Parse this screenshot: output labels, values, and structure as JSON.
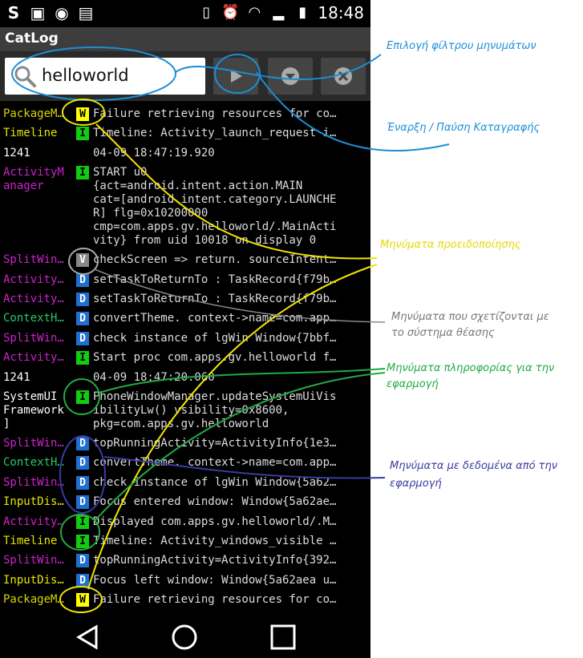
{
  "status_bar": {
    "left_icons": [
      "swiftkey-icon",
      "gallery-icon",
      "browser-icon",
      "briefcase-icon"
    ],
    "right_icons": [
      "vibrate-icon",
      "alarm-icon",
      "wifi-icon",
      "signal-icon",
      "battery-icon"
    ],
    "time": "18:48"
  },
  "app": {
    "title": "CatLog"
  },
  "toolbar": {
    "search_value": "helloworld",
    "play_icon": "play-icon",
    "expand_icon": "expand-icon",
    "clear_icon": "clear-icon"
  },
  "log_rows": [
    {
      "tag": "PackageM…",
      "level": "W",
      "lines": [
        "Failure retrieving resources for co…"
      ]
    },
    {
      "tag": "Timeline",
      "level": "I",
      "lines": [
        "Timeline: Activity_launch_request i…"
      ]
    },
    {
      "tag": "1241",
      "level": "",
      "lines": [
        "04-09 18:47:19.920"
      ]
    },
    {
      "tag": "ActivityM\nanager",
      "level": "I",
      "lines": [
        "START u0",
        "{act=android.intent.action.MAIN",
        "cat=[android.intent.category.LAUNCHE",
        "R] flg=0x10200000",
        "cmp=com.apps.gv.helloworld/.MainActi",
        "vity} from uid 10018 on display 0"
      ]
    },
    {
      "tag": "SplitWin…",
      "level": "V",
      "lines": [
        "checkScreen => return. sourceIntent…"
      ]
    },
    {
      "tag": "Activity…",
      "level": "D",
      "lines": [
        "setTaskToReturnTo : TaskRecord{f79b…"
      ]
    },
    {
      "tag": "Activity…",
      "level": "D",
      "lines": [
        "setTaskToReturnTo : TaskRecord{f79b…"
      ]
    },
    {
      "tag": "ContextH…",
      "level": "D",
      "lines": [
        "convertTheme. context->name=com.app…"
      ]
    },
    {
      "tag": "SplitWin…",
      "level": "D",
      "lines": [
        "check instance of lgWin Window{7bbf…"
      ]
    },
    {
      "tag": "Activity…",
      "level": "I",
      "lines": [
        "Start proc com.apps.gv.helloworld f…"
      ]
    },
    {
      "tag": "1241",
      "level": "",
      "lines": [
        "04-09 18:47:20.060"
      ]
    },
    {
      "tag": "SystemUI\nFramework\n]",
      "level": "I",
      "lines": [
        "PhoneWindowManager.updateSystemUiVis",
        "ibilityLw() vsibility=0x8600,",
        "pkg=com.apps.gv.helloworld"
      ]
    },
    {
      "tag": "SplitWin…",
      "level": "D",
      "lines": [
        "topRunningActivity=ActivityInfo{1e3…"
      ]
    },
    {
      "tag": "ContextH…",
      "level": "D",
      "lines": [
        "convertTheme. context->name=com.app…"
      ]
    },
    {
      "tag": "SplitWin…",
      "level": "D",
      "lines": [
        "check instance of lgWin Window{5a62…"
      ]
    },
    {
      "tag": "InputDis…",
      "level": "D",
      "lines": [
        "Focus entered window: Window{5a62ae…"
      ]
    },
    {
      "tag": "Activity…",
      "level": "I",
      "lines": [
        "Displayed com.apps.gv.helloworld/.M…"
      ]
    },
    {
      "tag": "Timeline",
      "level": "I",
      "lines": [
        "Timeline: Activity_windows_visible …"
      ]
    },
    {
      "tag": "SplitWin…",
      "level": "D",
      "lines": [
        "topRunningActivity=ActivityInfo{392…"
      ]
    },
    {
      "tag": "InputDis…",
      "level": "D",
      "lines": [
        "Focus left window: Window{5a62aea u…"
      ]
    },
    {
      "tag": "PackageM…",
      "level": "W",
      "lines": [
        "Failure retrieving resources for co…"
      ]
    }
  ],
  "annotations": {
    "filter": "Επιλογή φίλτρου μηνυμάτων",
    "record": "Έναρξη / Παύση Καταγραφής",
    "warnings": "Μηνύματα προειδοποίησης",
    "system_line1": "Μηνύματα που σχετίζονται με",
    "system_line2": "το σύστημα θέασης",
    "info_line1": "Μηνύματα πληροφορίας για την",
    "info_line2": "εφαρμογή",
    "debug_line1": "Μηνύματα με δεδομένα από την",
    "debug_line2": "εφαρμογή"
  },
  "colors": {
    "warn": "#ffff00",
    "info": "#11cc11",
    "verbose": "#888888",
    "debug": "#1f6fd1",
    "ann_blue": "#1a8fd6",
    "ann_yellow": "#f2e600",
    "ann_gray": "#777777",
    "ann_green": "#22aa44",
    "ann_purple": "#3a3aa0"
  },
  "navbar": {
    "icons": [
      "back-icon",
      "home-icon",
      "recents-icon"
    ]
  }
}
